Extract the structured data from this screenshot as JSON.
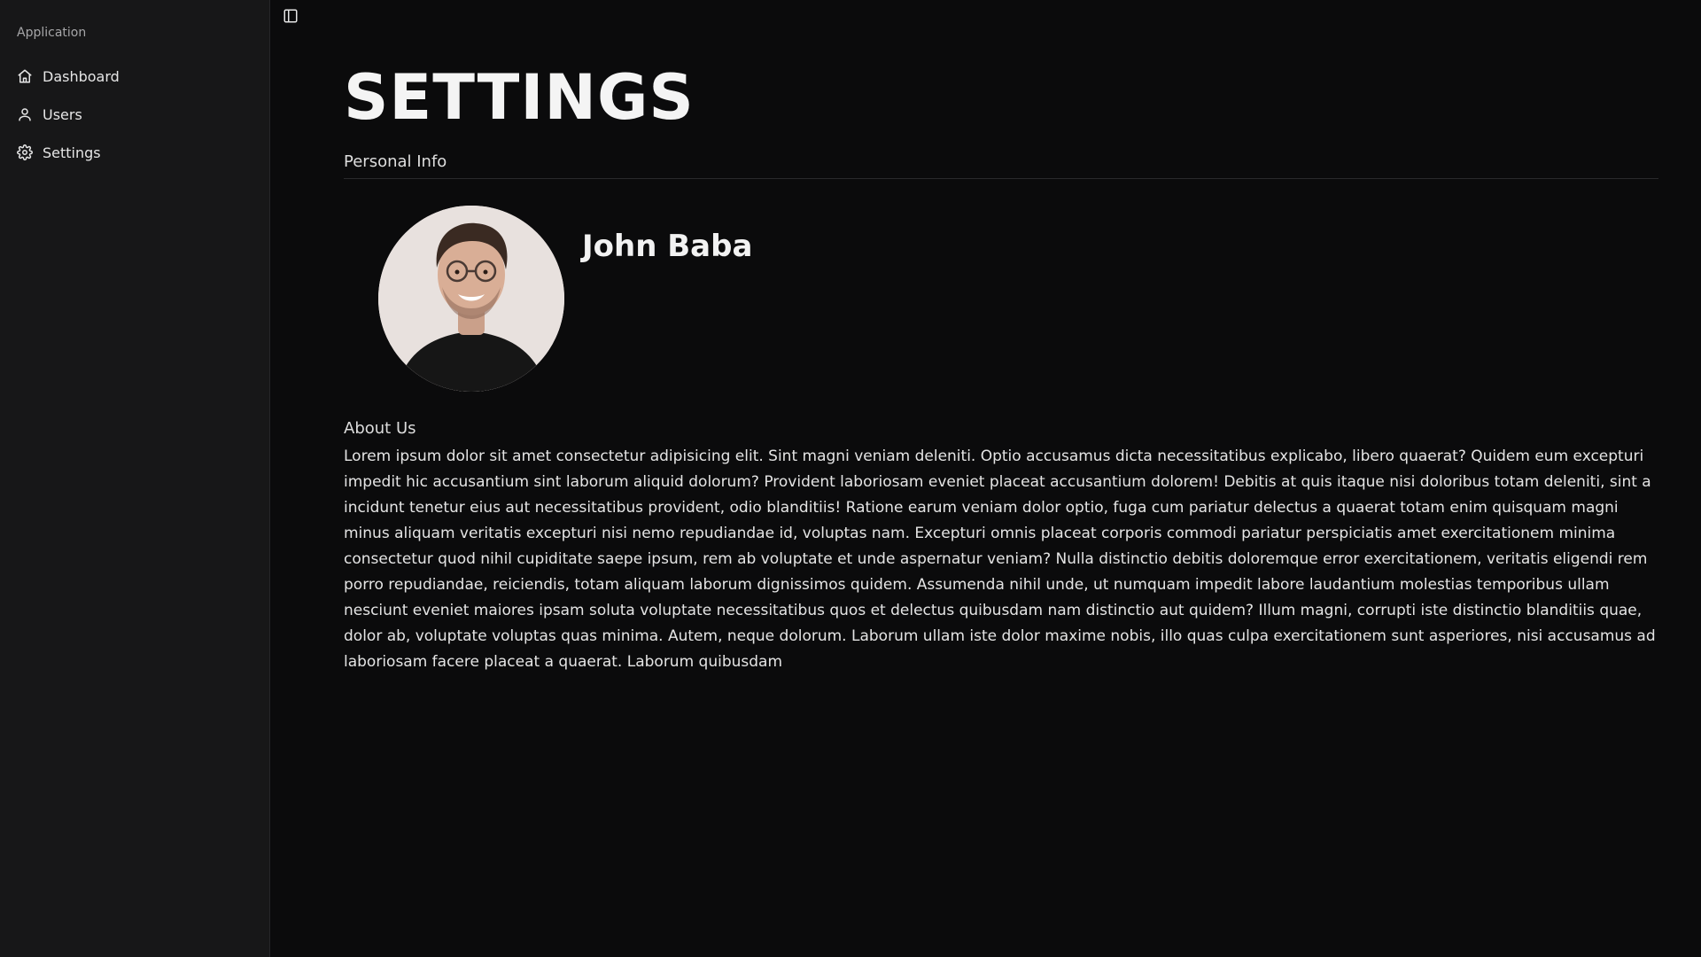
{
  "sidebar": {
    "group_label": "Application",
    "items": [
      {
        "label": "Dashboard",
        "icon": "home-icon"
      },
      {
        "label": "Users",
        "icon": "user-icon"
      },
      {
        "label": "Settings",
        "icon": "gear-icon"
      }
    ]
  },
  "header": {
    "toggle_icon": "sidebar-toggle-icon"
  },
  "main": {
    "title": "SETTINGS",
    "section_label": "Personal Info",
    "profile": {
      "name": "John Baba",
      "avatar_icon": "avatar-photo"
    },
    "about_label": "About Us",
    "about_text": "Lorem ipsum dolor sit amet consectetur adipisicing elit. Sint magni veniam deleniti. Optio accusamus dicta necessitatibus explicabo, libero quaerat? Quidem eum excepturi impedit hic accusantium sint laborum aliquid dolorum? Provident laboriosam eveniet placeat accusantium dolorem! Debitis at quis itaque nisi doloribus totam deleniti, sint a incidunt tenetur eius aut necessitatibus provident, odio blanditiis! Ratione earum veniam dolor optio, fuga cum pariatur delectus a quaerat totam enim quisquam magni minus aliquam veritatis excepturi nisi nemo repudiandae id, voluptas nam. Excepturi omnis placeat corporis commodi pariatur perspiciatis amet exercitationem minima consectetur quod nihil cupiditate saepe ipsum, rem ab voluptate et unde aspernatur veniam? Nulla distinctio debitis doloremque error exercitationem, veritatis eligendi rem porro repudiandae, reiciendis, totam aliquam laborum dignissimos quidem. Assumenda nihil unde, ut numquam impedit labore laudantium molestias temporibus ullam nesciunt eveniet maiores ipsam soluta voluptate necessitatibus quos et delectus quibusdam nam distinctio aut quidem? Illum magni, corrupti iste distinctio blanditiis quae, dolor ab, voluptate voluptas quas minima. Autem, neque dolorum. Laborum ullam iste dolor maxime nobis, illo quas culpa exercitationem sunt asperiores, nisi accusamus ad laboriosam facere placeat a quaerat. Laborum quibusdam"
  },
  "colors": {
    "background": "#0b0b0c",
    "sidebar_background": "#171718",
    "text": "#ececec"
  }
}
